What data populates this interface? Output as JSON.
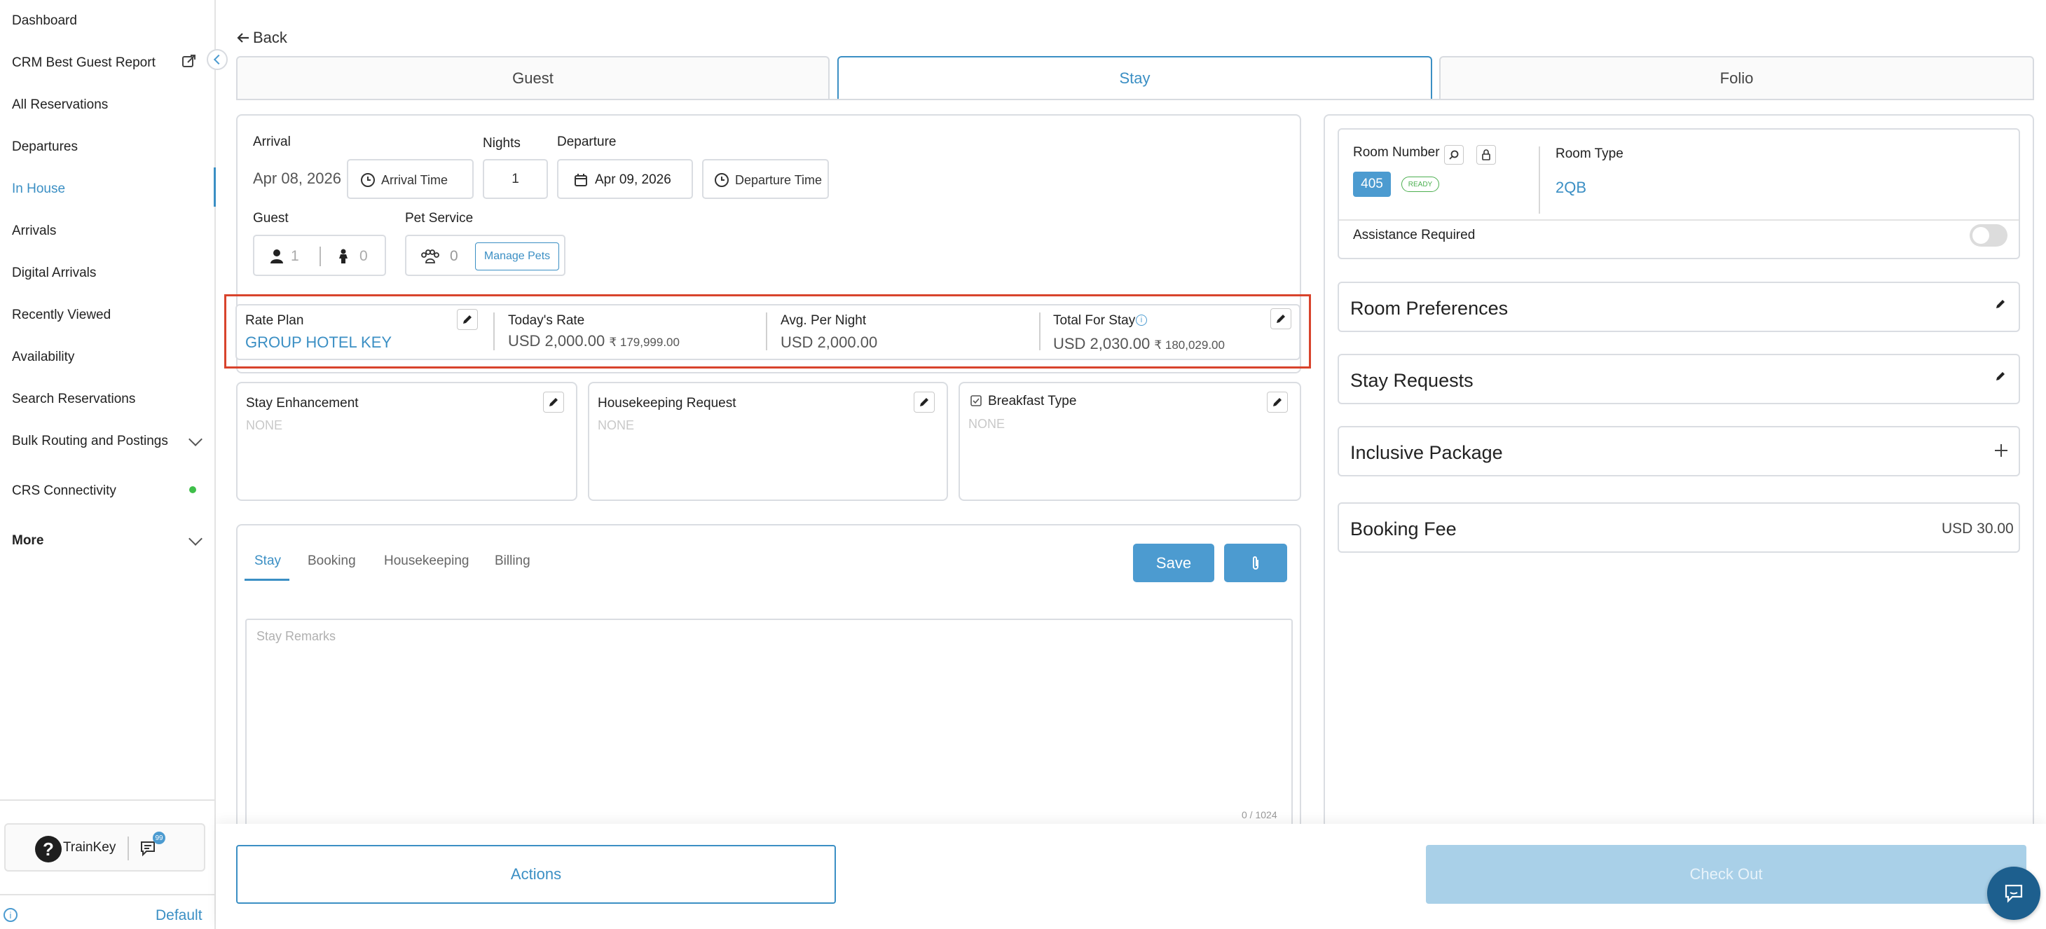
{
  "sidebar": {
    "items": [
      {
        "label": "Dashboard"
      },
      {
        "label": "CRM Best Guest Report"
      },
      {
        "label": "All Reservations"
      },
      {
        "label": "Departures"
      },
      {
        "label": "In House"
      },
      {
        "label": "Arrivals"
      },
      {
        "label": "Digital Arrivals"
      },
      {
        "label": "Recently Viewed"
      },
      {
        "label": "Availability"
      },
      {
        "label": "Search Reservations"
      },
      {
        "label": "Bulk Routing and Postings"
      },
      {
        "label": "CRS Connectivity"
      },
      {
        "label": "More"
      }
    ],
    "active_item": "In House",
    "trainkey_label": "TrainKey",
    "chat_badge": "99",
    "default_label": "Default",
    "status_color": "#3fbf4a"
  },
  "header": {
    "back_label": "Back"
  },
  "tabs": [
    {
      "label": "Guest"
    },
    {
      "label": "Stay"
    },
    {
      "label": "Folio"
    }
  ],
  "selected_tab": "Stay",
  "stay": {
    "arrival_label": "Arrival",
    "arrival_date": "Apr 08, 2026",
    "arrival_time_label": "Arrival Time",
    "nights_label": "Nights",
    "nights_value": "1",
    "departure_label": "Departure",
    "departure_date": "Apr 09, 2026",
    "departure_time_label": "Departure Time",
    "guest_label": "Guest",
    "adults": "1",
    "children": "0",
    "pet_label": "Pet Service",
    "pets": "0",
    "manage_pets_label": "Manage Pets"
  },
  "rate": {
    "rate_plan_label": "Rate Plan",
    "rate_plan_value": "GROUP HOTEL KEY",
    "todays_rate_label": "Today's Rate",
    "todays_rate_value": "USD 2,000.00",
    "todays_rate_inr": "₹ 179,999.00",
    "avg_label": "Avg. Per Night",
    "avg_value": "USD 2,000.00",
    "total_label": "Total For Stay",
    "total_value": "USD 2,030.00",
    "total_inr": "₹ 180,029.00"
  },
  "enhancements": {
    "stay_enhancement_label": "Stay Enhancement",
    "stay_enhancement_value": "NONE",
    "housekeeping_label": "Housekeeping Request",
    "housekeeping_value": "NONE",
    "breakfast_label": "Breakfast Type",
    "breakfast_value": "NONE"
  },
  "remarks": {
    "tabs": [
      {
        "label": "Stay"
      },
      {
        "label": "Booking"
      },
      {
        "label": "Housekeeping"
      },
      {
        "label": "Billing"
      }
    ],
    "selected": "Stay",
    "save_label": "Save",
    "placeholder": "Stay Remarks",
    "counter": "0 / 1024"
  },
  "room": {
    "room_number_label": "Room Number",
    "room_number": "405",
    "ready_badge": "READY",
    "room_type_label": "Room Type",
    "room_type": "2QB",
    "assistance_label": "Assistance Required"
  },
  "panels": {
    "room_preferences": "Room Preferences",
    "stay_requests": "Stay Requests",
    "inclusive_package": "Inclusive Package",
    "booking_fee": "Booking Fee",
    "booking_fee_value": "USD 30.00"
  },
  "footer": {
    "actions_label": "Actions",
    "checkout_label": "Check Out"
  },
  "colors": {
    "accent": "#3b8fc4",
    "highlight_border": "#d8432c",
    "ready": "#4caf50",
    "checkout_disabled": "#a9d0e8"
  }
}
